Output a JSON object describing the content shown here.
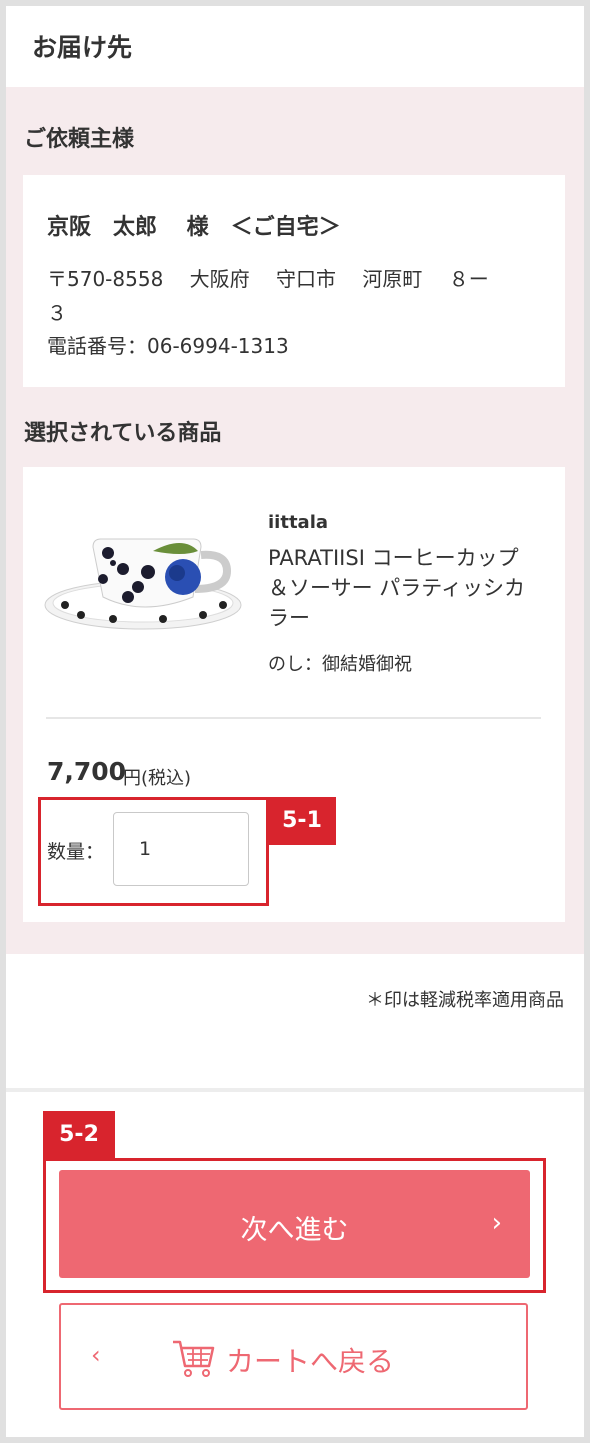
{
  "header": {
    "title": "お届け先"
  },
  "requester": {
    "heading": "ご依頼主様",
    "name": "京阪　太郎　 様　＜ご自宅＞",
    "address_line1": "〒570-8558　 大阪府　 守口市　 河原町　 ８ー",
    "address_line2": "３",
    "phone": "電話番号：06-6994-1313"
  },
  "products": {
    "heading": "選択されている商品",
    "item": {
      "brand": "iittala",
      "name": "PARATIISI コーヒーカップ＆ソーサー パラティッシカラー",
      "noshi": "のし：御結婚御祝",
      "price": "7,700",
      "price_unit": "円(税込)",
      "quantity_label": "数量：",
      "quantity": "1"
    }
  },
  "annotations": {
    "tag1": "5-1",
    "tag2": "5-2"
  },
  "note": "＊印は軽減税率適用商品",
  "buttons": {
    "next": "次へ進む",
    "next_arrow": "›",
    "back": "カートへ戻る",
    "back_arrow": "‹"
  },
  "colors": {
    "accent": "#ee6872",
    "highlight": "#d8242d",
    "section_bg": "#f6ebed"
  }
}
